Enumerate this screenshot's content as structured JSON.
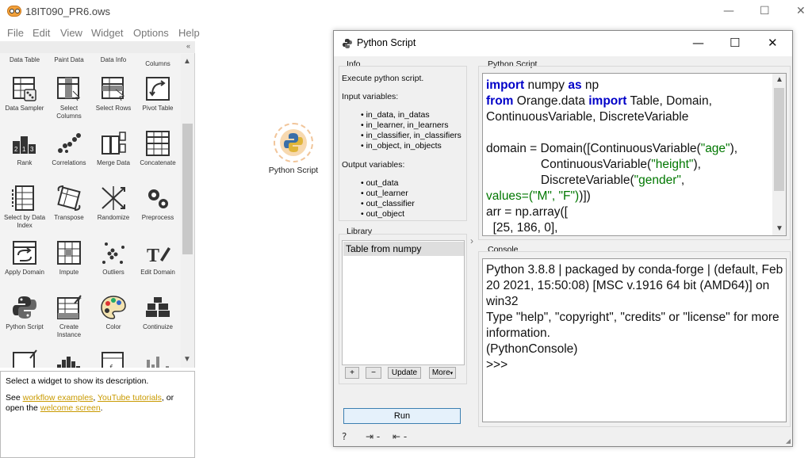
{
  "app": {
    "title": "18IT090_PR6.ows",
    "menu": [
      "File",
      "Edit",
      "View",
      "Widget",
      "Options",
      "Help"
    ]
  },
  "palette": {
    "top_labels": [
      "Data Table",
      "Paint Data",
      "Data Info",
      "Columns"
    ],
    "widgets": [
      {
        "label": "Data Sampler",
        "icon": "data-sampler-icon"
      },
      {
        "label": "Select Columns",
        "icon": "select-columns-icon"
      },
      {
        "label": "Select Rows",
        "icon": "select-rows-icon"
      },
      {
        "label": "Pivot Table",
        "icon": "pivot-table-icon"
      },
      {
        "label": "Rank",
        "icon": "rank-icon"
      },
      {
        "label": "Correlations",
        "icon": "correlations-icon"
      },
      {
        "label": "Merge Data",
        "icon": "merge-data-icon"
      },
      {
        "label": "Concatenate",
        "icon": "concatenate-icon"
      },
      {
        "label": "Select by Data Index",
        "icon": "select-by-index-icon"
      },
      {
        "label": "Transpose",
        "icon": "transpose-icon"
      },
      {
        "label": "Randomize",
        "icon": "randomize-icon"
      },
      {
        "label": "Preprocess",
        "icon": "preprocess-icon"
      },
      {
        "label": "Apply Domain",
        "icon": "apply-domain-icon"
      },
      {
        "label": "Impute",
        "icon": "impute-icon"
      },
      {
        "label": "Outliers",
        "icon": "outliers-icon"
      },
      {
        "label": "Edit Domain",
        "icon": "edit-domain-icon"
      },
      {
        "label": "Python Script",
        "icon": "python-icon"
      },
      {
        "label": "Create Instance",
        "icon": "create-instance-icon"
      },
      {
        "label": "Color",
        "icon": "color-palette-icon"
      },
      {
        "label": "Continuize",
        "icon": "continuize-icon"
      }
    ],
    "description": {
      "line1": "Select a widget to show its description.",
      "see": "See ",
      "link1": "workflow examples",
      "comma": ", ",
      "link2": "YouTube tutorials",
      "or": ", or",
      "open": "open the ",
      "link3": "welcome screen",
      "period": "."
    }
  },
  "canvas": {
    "node_label": "Python Script"
  },
  "dialog": {
    "title": "Python Script",
    "info": {
      "group": "Info",
      "desc": "Execute python script.",
      "inputs_heading": "Input variables:",
      "inputs": [
        "in_data, in_datas",
        "in_learner, in_learners",
        "in_classifier, in_classifiers",
        "in_object, in_objects"
      ],
      "outputs_heading": "Output variables:",
      "outputs": [
        "out_data",
        "out_learner",
        "out_classifier",
        "out_object"
      ]
    },
    "library": {
      "group": "Library",
      "items": [
        "Table from numpy"
      ],
      "add": "+",
      "remove": "−",
      "update": "Update",
      "more": "More"
    },
    "run": "Run",
    "script_group": "Python Script",
    "console_group": "Console",
    "console_lines": [
      "Python 3.8.8 | packaged by conda-forge | (default, Feb 20 2021, 15:50:08) [MSC v.1916 64 bit (AMD64)] on win32",
      "Type \"help\", \"copyright\", \"credits\" or \"license\" for more information.",
      "(PythonConsole)",
      ">>>"
    ]
  }
}
